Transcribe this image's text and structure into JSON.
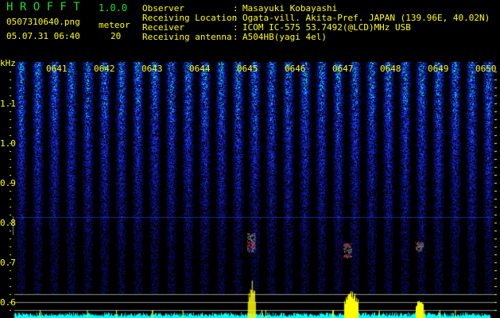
{
  "header": {
    "app_name": "H R O F F T",
    "version": "1.0.0",
    "filename": "0507310640.png",
    "datetime": "05.07.31 06:40",
    "meteor_label": "meteor",
    "meteor_count": "20",
    "info": [
      {
        "label": "Observer",
        "value": "Masayuki Kobayashi"
      },
      {
        "label": "Receiving Location",
        "value": "Ogata-vill. Akita-Pref. JAPAN (139.96E, 40.02N)"
      },
      {
        "label": "Receiver",
        "value": "ICOM IC-575 53.7492(@LCD)MHz USB"
      },
      {
        "label": "Receiving antenna",
        "value": "A504HB(yagi 4el)"
      }
    ]
  },
  "colors": {
    "text": "#ffff00",
    "title": "#22dd22",
    "baseline": "#00ffff",
    "peak": "#ffff00",
    "background": "#000000"
  },
  "chart_data": {
    "type": "heatmap",
    "title": "HROFFT spectrogram",
    "ylabel": "kHz",
    "xlabel": "",
    "x_ticks": [
      "0641",
      "0642",
      "0643",
      "0644",
      "0645",
      "0646",
      "0647",
      "0648",
      "0649",
      "0650"
    ],
    "x_range_minutes": [
      40.35,
      50.4
    ],
    "y_ticks": [
      "1.1",
      "1.0",
      "0.9",
      "0.8",
      "0.7",
      "0.6"
    ],
    "y_tick_values": [
      1.1,
      1.0,
      0.9,
      0.8,
      0.7,
      0.6
    ],
    "y_range_khz": [
      0.56,
      1.2
    ],
    "echoes": [
      {
        "time_min": 45.28,
        "freq_khz": 0.75,
        "strength": 1.0
      },
      {
        "time_min": 47.3,
        "freq_khz": 0.73,
        "strength": 0.75
      },
      {
        "time_min": 48.8,
        "freq_khz": 0.74,
        "strength": 0.5
      }
    ]
  }
}
